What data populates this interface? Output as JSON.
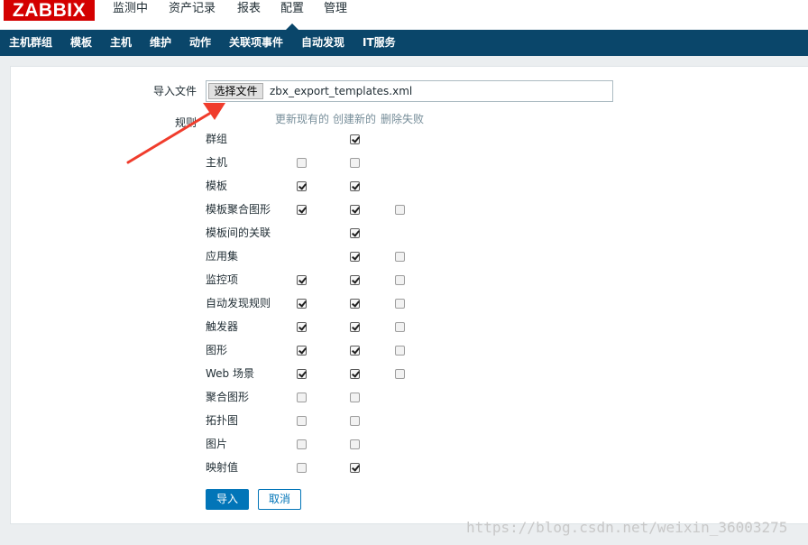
{
  "header": {
    "logo": "ZABBIX",
    "nav": [
      {
        "label": "监测中"
      },
      {
        "label": "资产记录"
      },
      {
        "label": "报表"
      },
      {
        "label": "配置"
      },
      {
        "label": "管理"
      }
    ],
    "active_index": 3
  },
  "subnav": [
    {
      "label": "主机群组"
    },
    {
      "label": "模板"
    },
    {
      "label": "主机"
    },
    {
      "label": "维护"
    },
    {
      "label": "动作"
    },
    {
      "label": "关联项事件"
    },
    {
      "label": "自动发现"
    },
    {
      "label": "IT服务"
    }
  ],
  "form": {
    "import_file_label": "导入文件",
    "choose_file_button": "选择文件",
    "file_name": "zbx_export_templates.xml",
    "rules_label": "规则",
    "columns": [
      "更新现有的",
      "创建新的",
      "删除失败"
    ],
    "rules": [
      {
        "label": "群组",
        "update": null,
        "create": true,
        "delete": null
      },
      {
        "label": "主机",
        "update": false,
        "create": false,
        "delete": null
      },
      {
        "label": "模板",
        "update": true,
        "create": true,
        "delete": null
      },
      {
        "label": "模板聚合图形",
        "update": true,
        "create": true,
        "delete": false
      },
      {
        "label": "模板间的关联",
        "update": null,
        "create": true,
        "delete": null
      },
      {
        "label": "应用集",
        "update": null,
        "create": true,
        "delete": false
      },
      {
        "label": "监控项",
        "update": true,
        "create": true,
        "delete": false
      },
      {
        "label": "自动发现规则",
        "update": true,
        "create": true,
        "delete": false
      },
      {
        "label": "触发器",
        "update": true,
        "create": true,
        "delete": false
      },
      {
        "label": "图形",
        "update": true,
        "create": true,
        "delete": false
      },
      {
        "label": "Web 场景",
        "update": true,
        "create": true,
        "delete": false
      },
      {
        "label": "聚合图形",
        "update": false,
        "create": false,
        "delete": null
      },
      {
        "label": "拓扑图",
        "update": false,
        "create": false,
        "delete": null
      },
      {
        "label": "图片",
        "update": false,
        "create": false,
        "delete": null
      },
      {
        "label": "映射值",
        "update": false,
        "create": true,
        "delete": null
      }
    ],
    "import_button": "导入",
    "cancel_button": "取消"
  },
  "annotation": {
    "color": "#f03c2c"
  },
  "watermark": "https://blog.csdn.net/weixin_36003275",
  "colors": {
    "brand": "#d40000",
    "subnav_bg": "#0a466a",
    "primary": "#0275b8"
  }
}
